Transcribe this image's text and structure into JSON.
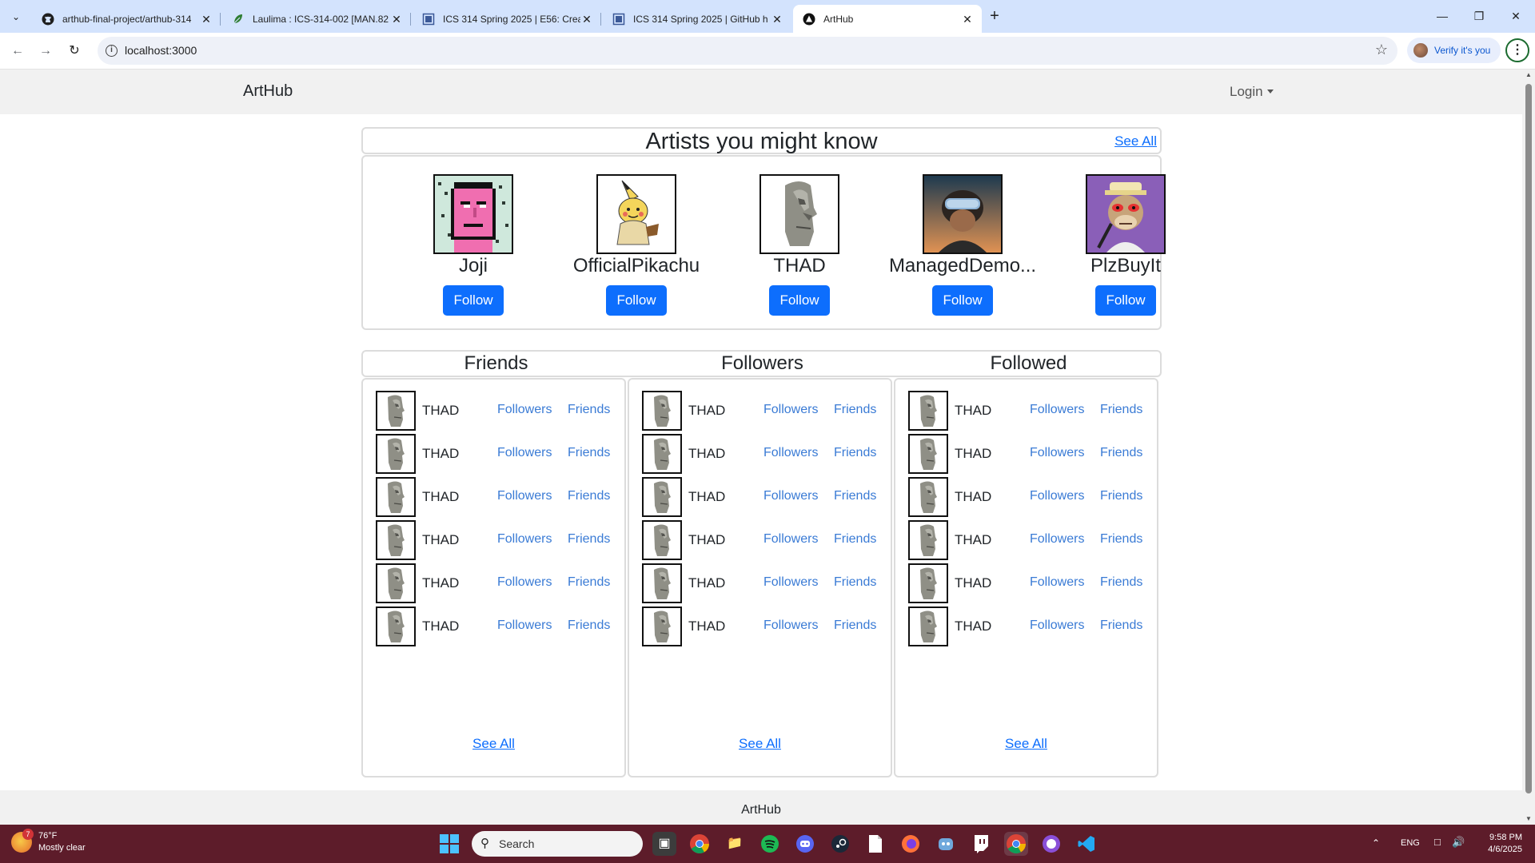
{
  "browser": {
    "tabs": [
      {
        "title": "arthub-final-project/arthub-314",
        "icon": "github-icon"
      },
      {
        "title": "Laulima : ICS-314-002 [MAN.82",
        "icon": "laulima-icon"
      },
      {
        "title": "ICS 314 Spring 2025 | E56: Crea",
        "icon": "doc-icon"
      },
      {
        "title": "ICS 314 Spring 2025 | GitHub h",
        "icon": "doc-icon"
      },
      {
        "title": "ArtHub",
        "icon": "arthub-icon",
        "active": true
      }
    ],
    "url": "localhost:3000",
    "verify_label": "Verify it's you"
  },
  "navbar": {
    "brand": "ArtHub",
    "login_label": "Login"
  },
  "artists_section": {
    "title": "Artists you might know",
    "see_all": "See All",
    "artists": [
      {
        "name": "Joji",
        "button": "Follow",
        "avatar": "pixel-pink-face"
      },
      {
        "name": "OfficialPikachu",
        "button": "Follow",
        "avatar": "mimikyu-plush"
      },
      {
        "name": "THAD",
        "button": "Follow",
        "avatar": "moai-statue"
      },
      {
        "name": "ManagedDemo...",
        "button": "Follow",
        "avatar": "goggles-portrait"
      },
      {
        "name": "PlzBuyIt",
        "button": "Follow",
        "avatar": "bored-ape"
      }
    ]
  },
  "connections": {
    "columns": [
      {
        "title": "Friends",
        "see_all": "See All",
        "rows": [
          {
            "name": "THAD",
            "link1": "Followers",
            "link2": "Friends"
          },
          {
            "name": "THAD",
            "link1": "Followers",
            "link2": "Friends"
          },
          {
            "name": "THAD",
            "link1": "Followers",
            "link2": "Friends"
          },
          {
            "name": "THAD",
            "link1": "Followers",
            "link2": "Friends"
          },
          {
            "name": "THAD",
            "link1": "Followers",
            "link2": "Friends"
          },
          {
            "name": "THAD",
            "link1": "Followers",
            "link2": "Friends"
          }
        ]
      },
      {
        "title": "Followers",
        "see_all": "See All",
        "rows": [
          {
            "name": "THAD",
            "link1": "Followers",
            "link2": "Friends"
          },
          {
            "name": "THAD",
            "link1": "Followers",
            "link2": "Friends"
          },
          {
            "name": "THAD",
            "link1": "Followers",
            "link2": "Friends"
          },
          {
            "name": "THAD",
            "link1": "Followers",
            "link2": "Friends"
          },
          {
            "name": "THAD",
            "link1": "Followers",
            "link2": "Friends"
          },
          {
            "name": "THAD",
            "link1": "Followers",
            "link2": "Friends"
          }
        ]
      },
      {
        "title": "Followed",
        "see_all": "See All",
        "rows": [
          {
            "name": "THAD",
            "link1": "Followers",
            "link2": "Friends"
          },
          {
            "name": "THAD",
            "link1": "Followers",
            "link2": "Friends"
          },
          {
            "name": "THAD",
            "link1": "Followers",
            "link2": "Friends"
          },
          {
            "name": "THAD",
            "link1": "Followers",
            "link2": "Friends"
          },
          {
            "name": "THAD",
            "link1": "Followers",
            "link2": "Friends"
          },
          {
            "name": "THAD",
            "link1": "Followers",
            "link2": "Friends"
          }
        ]
      }
    ]
  },
  "footer": {
    "text": "ArtHub"
  },
  "taskbar": {
    "weather_temp": "76°F",
    "weather_desc": "Mostly clear",
    "weather_badge": "7",
    "search_label": "Search",
    "lang": "ENG",
    "time": "9:58 PM",
    "date": "4/6/2025"
  },
  "colors": {
    "primary": "#0d6efd",
    "link": "#3a7bd5",
    "tabstrip": "#d3e3fd",
    "taskbar": "#5d1c2a"
  }
}
